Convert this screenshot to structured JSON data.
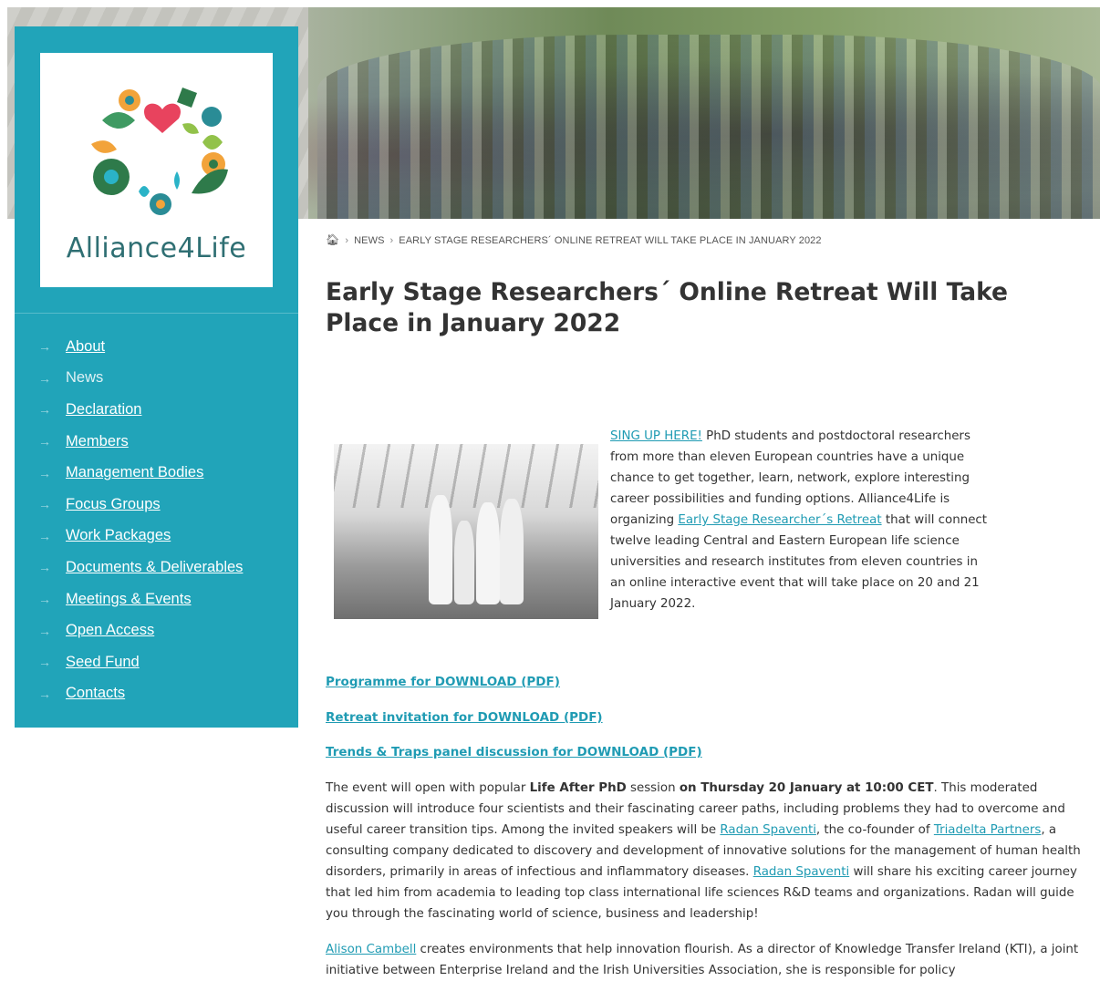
{
  "site": {
    "name": "Alliance4Life"
  },
  "nav": {
    "items": [
      {
        "label": "About",
        "current": false
      },
      {
        "label": "News",
        "current": true
      },
      {
        "label": "Declaration",
        "current": false
      },
      {
        "label": "Members",
        "current": false
      },
      {
        "label": "Management Bodies",
        "current": false
      },
      {
        "label": "Focus Groups",
        "current": false
      },
      {
        "label": "Work Packages",
        "current": false
      },
      {
        "label": "Documents & Deliverables",
        "current": false
      },
      {
        "label": "Meetings & Events",
        "current": false
      },
      {
        "label": "Open Access",
        "current": false
      },
      {
        "label": "Seed Fund",
        "current": false
      },
      {
        "label": "Contacts",
        "current": false
      }
    ]
  },
  "breadcrumb": {
    "section": "NEWS",
    "current": "EARLY STAGE RESEARCHERS´ ONLINE RETREAT WILL TAKE PLACE IN JANUARY 2022"
  },
  "article": {
    "title": "Early Stage Researchers´ Online Retreat Will Take Place in January 2022",
    "intro": {
      "signup_link": "SING UP HERE!",
      "text1": "  PhD students and postdoctoral researchers  from more than eleven European countries have a unique  chance to get together, learn, network, explore interesting  career possibilities and funding options. Alliance4Life is    organizing  ",
      "retreat_link": "Early Stage Researcher´s Retreat",
      "text2": " that will connect twelve leading Central and Eastern European life science universities and research institutes from eleven countries in an online interactive event that will take place on 20 and 21 January 2022."
    },
    "downloads": [
      "Programme for DOWNLOAD (PDF)",
      "Retreat invitation for DOWNLOAD (PDF)",
      "Trends & Traps panel discussion for DOWNLOAD (PDF)"
    ],
    "para1": {
      "t1": "The event will open with popular ",
      "b1": "Life After PhD",
      "t2": " session ",
      "b2": "on Thursday 20 January at 10:00 CET",
      "t3": ". This moderated discussion will introduce four scientists and their fascinating career paths, including problems they had to overcome and useful career transition tips. Among the invited speakers will be ",
      "l1": "Radan Spaventi",
      "t4": ", the co-founder of ",
      "l2": "Triadelta Partners",
      "t5": ", a consulting company dedicated to discovery and development of innovative solutions for the management of human health disorders, primarily in areas of infectious and inflammatory diseases. ",
      "l3": "Radan Spaventi",
      "t6": " will share his exciting career journey that led him from academia to leading top class international life sciences R&D teams and organizations. Radan will guide you through the fascinating world of science, business and leadership!"
    },
    "para2": {
      "l1": "Alison Cambell",
      "t1": " creates environments that help innovation flourish. As a director of Knowledge Transfer Ireland (KTI), a joint initiative between Enterprise Ireland and the Irish Universities Association, she is responsible for policy"
    }
  },
  "colors": {
    "sidebar": "#21a4b9",
    "link": "#1f9bb3",
    "text": "#333333"
  },
  "icons": {
    "breadcrumb_home": "home-icon",
    "nav_bullet": "arrow-right-icon"
  }
}
